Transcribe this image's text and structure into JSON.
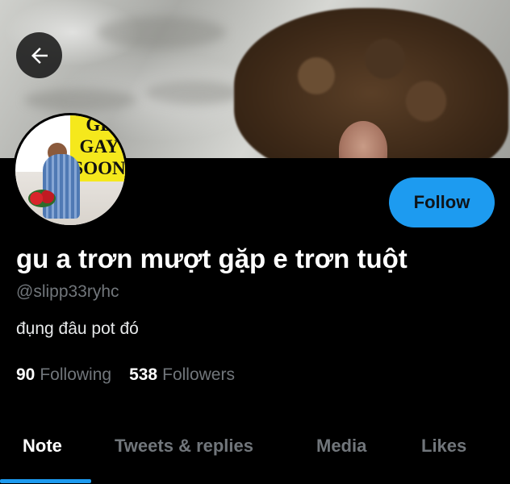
{
  "profile": {
    "display_name": "gu a trơn mượt gặp e trơn tuột",
    "handle": "@slipp33ryhc",
    "bio": "đụng đâu pot đó",
    "following_count": "90",
    "following_label": "Following",
    "followers_count": "538",
    "followers_label": "Followers",
    "avatar_sign_lines": [
      "GE",
      "GAY",
      "SOON"
    ]
  },
  "actions": {
    "follow_label": "Follow",
    "back_icon": "arrow-left-icon"
  },
  "tabs": [
    {
      "label": "Note",
      "active": true
    },
    {
      "label": "Tweets & replies",
      "active": false
    },
    {
      "label": "Media",
      "active": false
    },
    {
      "label": "Likes",
      "active": false
    }
  ],
  "colors": {
    "accent": "#1d9bf0",
    "background": "#000000",
    "muted_text": "#71767b"
  }
}
